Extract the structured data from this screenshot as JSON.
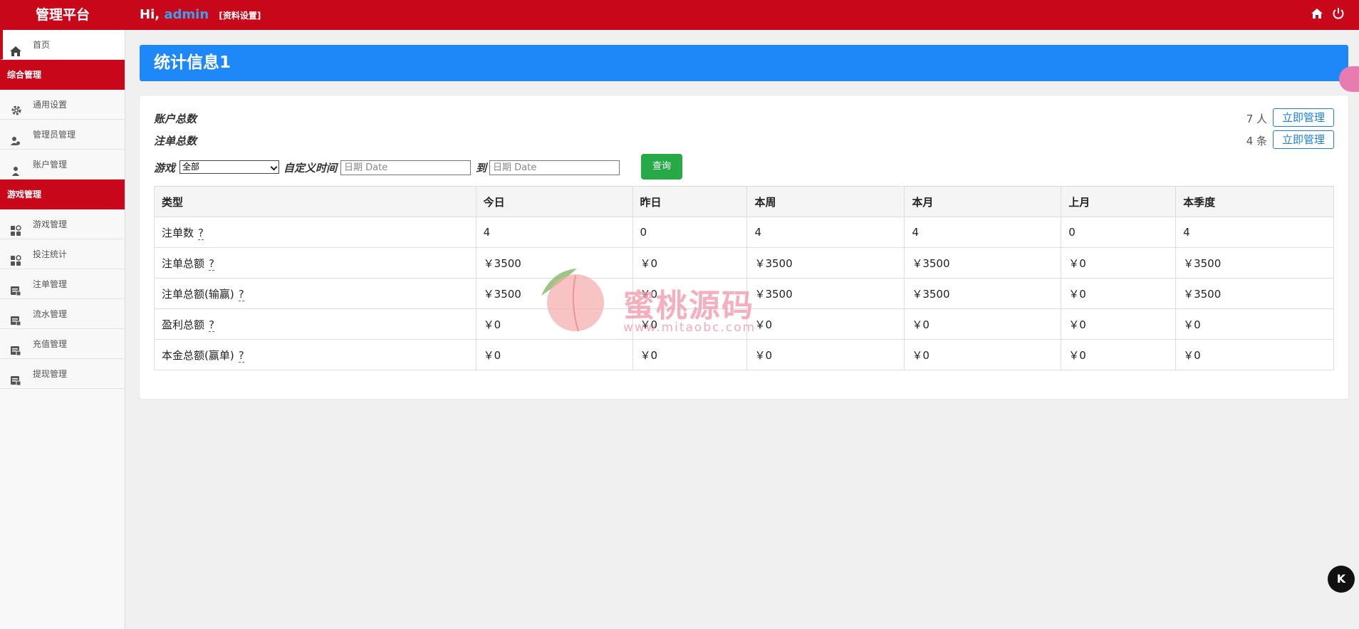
{
  "topbar": {
    "brand": "管理平台",
    "greeting": "Hi,",
    "username": "admin",
    "profile_link": "[资料设置]"
  },
  "sidebar": {
    "home": "首页",
    "section1": "综合管理",
    "section1_items": [
      "通用设置",
      "管理员管理",
      "账户管理"
    ],
    "section2": "游戏管理",
    "section2_items": [
      "游戏管理",
      "投注统计",
      "注单管理",
      "流水管理",
      "充值管理",
      "提现管理"
    ]
  },
  "page": {
    "title": "统计信息1"
  },
  "summary": {
    "accounts_label": "账户总数",
    "accounts_count": "7 人",
    "orders_label": "注单总数",
    "orders_count": "4 条",
    "manage_label": "立即管理"
  },
  "filter": {
    "game_label": "游戏",
    "game_selected": "全部",
    "custom_time_label": "自定义时间",
    "start_placeholder": "日期 Date",
    "to_label": "到",
    "end_placeholder": "日期 Date",
    "query_label": "查询"
  },
  "table": {
    "headers": [
      "类型",
      "今日",
      "昨日",
      "本周",
      "本月",
      "上月",
      "本季度"
    ],
    "help_mark": "?",
    "rows": [
      {
        "label": "注单数",
        "values": [
          "4",
          "0",
          "4",
          "4",
          "0",
          "4"
        ]
      },
      {
        "label": "注单总额",
        "values": [
          "￥3500",
          "￥0",
          "￥3500",
          "￥3500",
          "￥0",
          "￥3500"
        ]
      },
      {
        "label": "注单总额(输赢)",
        "values": [
          "￥3500",
          "￥0",
          "￥3500",
          "￥3500",
          "￥0",
          "￥3500"
        ]
      },
      {
        "label": "盈利总额",
        "values": [
          "￥0",
          "￥0",
          "￥0",
          "￥0",
          "￥0",
          "￥0"
        ]
      },
      {
        "label": "本金总额(赢单)",
        "values": [
          "￥0",
          "￥0",
          "￥0",
          "￥0",
          "￥0",
          "￥0"
        ]
      }
    ]
  },
  "watermark": {
    "text": "蜜桃源码",
    "url": "www.mitaobc.com"
  },
  "badge": "K",
  "colors": {
    "primary_red": "#c8081a",
    "title_blue": "#1e88f8",
    "query_green": "#26a947",
    "link_blue": "#1e7fd0"
  }
}
